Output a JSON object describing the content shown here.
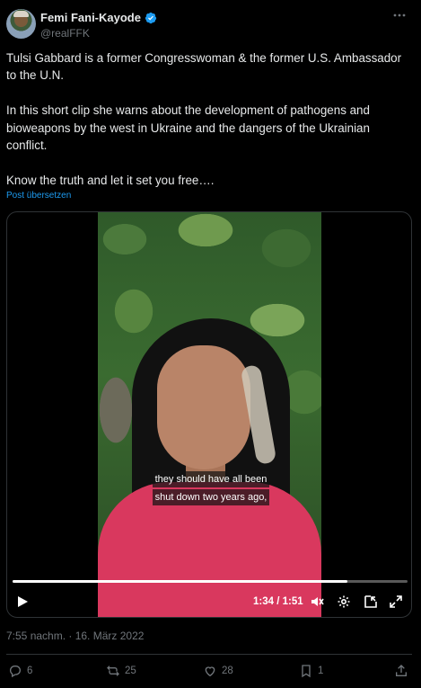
{
  "author": {
    "display_name": "Femi Fani-Kayode",
    "handle": "@realFFK"
  },
  "tweet": {
    "paragraphs": [
      "Tulsi Gabbard is a former Congresswoman & the former U.S. Ambassador to the U.N.",
      "In this short clip she warns about the development of pathogens and bioweapons by the west in Ukraine and the dangers of the Ukrainian conflict.",
      "Know the truth and let it set you free…."
    ],
    "translate_label": "Post übersetzen",
    "timestamp": "7:55 nachm. · 16. März 2022"
  },
  "video": {
    "caption_lines": [
      "they should have all been",
      "shut down two years ago,"
    ],
    "time_display": "1:34 / 1:51",
    "progress": 0.848
  },
  "actions": {
    "replies": "6",
    "reposts": "25",
    "likes": "28",
    "bookmarks": "1"
  },
  "colors": {
    "accent": "#1d9bf0",
    "muted": "#71767b",
    "background": "#000000"
  },
  "icons": [
    "verified-badge-icon",
    "more-icon",
    "play-icon",
    "volume-icon",
    "settings-icon",
    "pip-icon",
    "fullscreen-icon",
    "reply-icon",
    "repost-icon",
    "like-icon",
    "bookmark-icon",
    "share-icon"
  ]
}
